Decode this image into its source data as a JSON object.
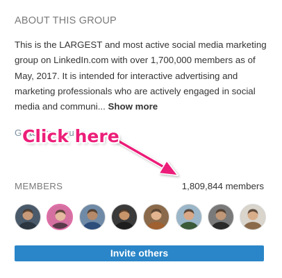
{
  "about": {
    "title": "ABOUT THIS GROUP",
    "description": "This is the LARGEST and most active social media marketing group on LinkedIn.com with over 1,700,000 members as of May, 2017. It is intended for interactive advertising and marketing professionals who are actively engaged in social media and communi...",
    "show_more_label": "Show more",
    "group_link_label": "Go to group rules"
  },
  "annotation": {
    "text": "Click here",
    "color": "#ec1e79"
  },
  "members": {
    "title": "MEMBERS",
    "count_label": "1,809,844 members",
    "avatars": [
      {
        "name": "member-1",
        "bg": "#4a5a6a",
        "skin": "#c89a7a",
        "shirt": "#2c3640"
      },
      {
        "name": "member-2",
        "bg": "#d46fa0",
        "skin": "#e5b8a0",
        "shirt": "#5a3a4a"
      },
      {
        "name": "member-3",
        "bg": "#6f8aa6",
        "skin": "#b58a6a",
        "shirt": "#2d4d7a"
      },
      {
        "name": "member-4",
        "bg": "#3a3a3a",
        "skin": "#c8946a",
        "shirt": "#1e1e1e"
      },
      {
        "name": "member-5",
        "bg": "#8a6a4a",
        "skin": "#e2b48f",
        "shirt": "#a06030"
      },
      {
        "name": "member-6",
        "bg": "#9ab6c8",
        "skin": "#d8a888",
        "shirt": "#3a5a3a"
      },
      {
        "name": "member-7",
        "bg": "#7a7a7a",
        "skin": "#c09878",
        "shirt": "#2a2a2a"
      },
      {
        "name": "member-8",
        "bg": "#d9d4cc",
        "skin": "#d8ad8a",
        "shirt": "#8a6a4a"
      }
    ]
  },
  "invite": {
    "label": "Invite others",
    "color": "#2a86c8"
  }
}
